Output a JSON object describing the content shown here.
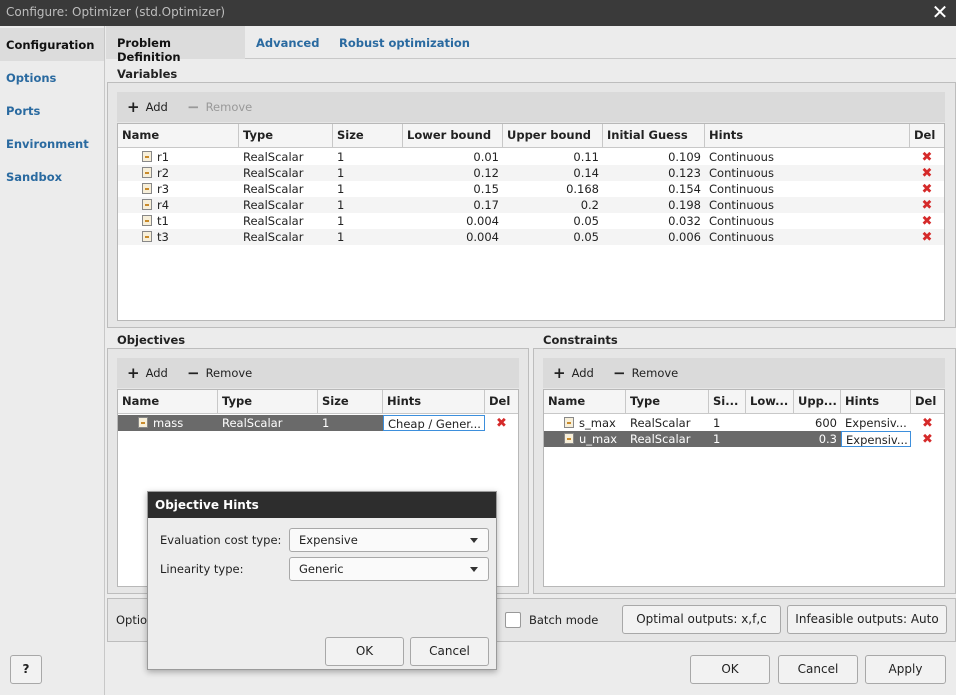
{
  "window": {
    "title": "Configure: Optimizer (std.Optimizer)"
  },
  "sidebar": {
    "items": [
      {
        "label": "Configuration",
        "active": true
      },
      {
        "label": "Options"
      },
      {
        "label": "Ports"
      },
      {
        "label": "Environment"
      },
      {
        "label": "Sandbox"
      }
    ]
  },
  "tabs": [
    {
      "label": "Problem Definition",
      "active": true
    },
    {
      "label": "Advanced"
    },
    {
      "label": "Robust optimization"
    }
  ],
  "variables": {
    "title": "Variables",
    "add_label": "Add",
    "remove_label": "Remove",
    "columns": [
      "Name",
      "Type",
      "Size",
      "Lower bound",
      "Upper bound",
      "Initial Guess",
      "Hints",
      "Del"
    ],
    "rows": [
      [
        "r1",
        "RealScalar",
        "1",
        "0.01",
        "0.11",
        "0.109",
        "Continuous"
      ],
      [
        "r2",
        "RealScalar",
        "1",
        "0.12",
        "0.14",
        "0.123",
        "Continuous"
      ],
      [
        "r3",
        "RealScalar",
        "1",
        "0.15",
        "0.168",
        "0.154",
        "Continuous"
      ],
      [
        "r4",
        "RealScalar",
        "1",
        "0.17",
        "0.2",
        "0.198",
        "Continuous"
      ],
      [
        "t1",
        "RealScalar",
        "1",
        "0.004",
        "0.05",
        "0.032",
        "Continuous"
      ],
      [
        "t3",
        "RealScalar",
        "1",
        "0.004",
        "0.05",
        "0.006",
        "Continuous"
      ]
    ]
  },
  "objectives": {
    "title": "Objectives",
    "add_label": "Add",
    "remove_label": "Remove",
    "columns": [
      "Name",
      "Type",
      "Size",
      "Hints",
      "Del"
    ],
    "rows": [
      [
        "mass",
        "RealScalar",
        "1",
        "Cheap / Gener..."
      ]
    ]
  },
  "constraints": {
    "title": "Constraints",
    "add_label": "Add",
    "remove_label": "Remove",
    "columns": [
      "Name",
      "Type",
      "Si...",
      "Low...",
      "Upp...",
      "Hints",
      "Del"
    ],
    "rows": [
      [
        "s_max",
        "RealScalar",
        "1",
        "",
        "600",
        "Expensiv..."
      ],
      [
        "u_max",
        "RealScalar",
        "1",
        "",
        "0.3",
        "Expensiv..."
      ]
    ]
  },
  "options_bar": {
    "label": "Optio",
    "batch_mode_label": "Batch mode",
    "optimal_outputs_label": "Optimal outputs: x,f,c",
    "infeasible_outputs_label": "Infeasible outputs: Auto"
  },
  "dialog": {
    "title": "Objective Hints",
    "eval_cost_label": "Evaluation cost type:",
    "eval_cost_value": "Expensive",
    "linearity_label": "Linearity type:",
    "linearity_value": "Generic",
    "ok_label": "OK",
    "cancel_label": "Cancel"
  },
  "footer": {
    "help_label": "?",
    "ok_label": "OK",
    "cancel_label": "Cancel",
    "apply_label": "Apply"
  },
  "icons": {
    "delete": "delete-x-icon",
    "variable": "variable-icon",
    "add": "plus-icon",
    "remove": "minus-icon"
  },
  "colors": {
    "link": "#2a6aa0",
    "delete": "#d52a2a",
    "selected_row": "#6a6a6a",
    "focus": "#3d8fdc"
  }
}
